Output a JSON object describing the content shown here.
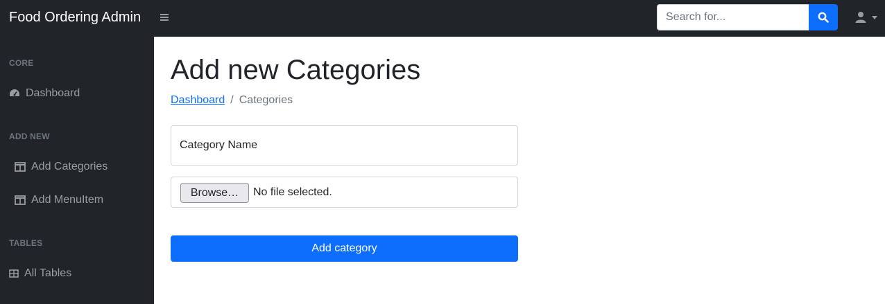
{
  "header": {
    "brand": "Food Ordering Admin",
    "search_placeholder": "Search for...",
    "search_icon": "search-icon",
    "user_icon": "user-icon",
    "menu_icon": "bars-icon"
  },
  "sidebar": {
    "sections": [
      {
        "heading": "CORE",
        "items": [
          {
            "label": "Dashboard",
            "icon": "tachometer-icon"
          }
        ]
      },
      {
        "heading": "ADD NEW",
        "items": [
          {
            "label": "Add Categories",
            "icon": "columns-icon"
          },
          {
            "label": "Add MenuItem",
            "icon": "columns-icon"
          }
        ]
      },
      {
        "heading": "TABLES",
        "items": [
          {
            "label": "All Tables",
            "icon": "table-icon"
          }
        ]
      }
    ]
  },
  "main": {
    "title": "Add new Categories",
    "breadcrumb": {
      "link": "Dashboard",
      "separator": "/",
      "current": "Categories"
    },
    "form": {
      "category_placeholder": "Category Name",
      "browse_label": "Browse…",
      "file_status": "No file selected.",
      "submit_label": "Add category"
    }
  },
  "colors": {
    "nav_bg": "#212529",
    "primary": "#0d6efd",
    "sidebar_text": "#9a9da0",
    "sidebar_heading": "#6c757d"
  }
}
